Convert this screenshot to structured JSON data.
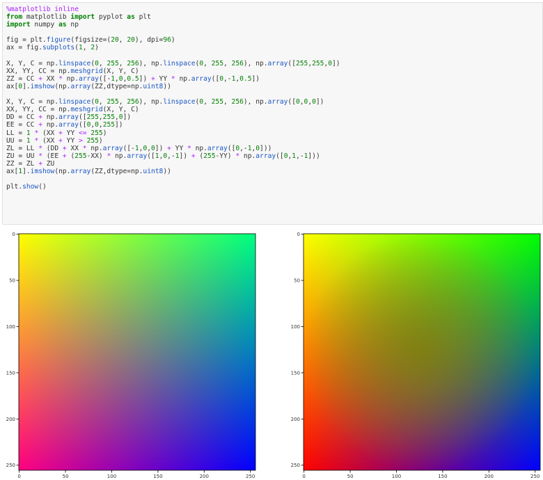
{
  "code_cell": {
    "lines": [
      [
        {
          "t": "%matplotlib inline",
          "c": "mag"
        }
      ],
      [
        {
          "t": "from",
          "c": "kw"
        },
        {
          "t": " matplotlib "
        },
        {
          "t": "import",
          "c": "kw"
        },
        {
          "t": " pyplot "
        },
        {
          "t": "as",
          "c": "kw"
        },
        {
          "t": " plt"
        }
      ],
      [
        {
          "t": "import",
          "c": "kw"
        },
        {
          "t": " numpy "
        },
        {
          "t": "as",
          "c": "kw"
        },
        {
          "t": " np"
        }
      ],
      [],
      [
        {
          "t": "fig = plt."
        },
        {
          "t": "figure",
          "c": "fn"
        },
        {
          "t": "(figsize=("
        },
        {
          "t": "20",
          "c": "num"
        },
        {
          "t": ", "
        },
        {
          "t": "20",
          "c": "num"
        },
        {
          "t": "), dpi="
        },
        {
          "t": "96",
          "c": "num"
        },
        {
          "t": ")"
        }
      ],
      [
        {
          "t": "ax = fig."
        },
        {
          "t": "subplots",
          "c": "fn"
        },
        {
          "t": "("
        },
        {
          "t": "1",
          "c": "num"
        },
        {
          "t": ", "
        },
        {
          "t": "2",
          "c": "num"
        },
        {
          "t": ")"
        }
      ],
      [],
      [
        {
          "t": "X, Y, C = np."
        },
        {
          "t": "linspace",
          "c": "fn"
        },
        {
          "t": "("
        },
        {
          "t": "0",
          "c": "num"
        },
        {
          "t": ", "
        },
        {
          "t": "255",
          "c": "num"
        },
        {
          "t": ", "
        },
        {
          "t": "256",
          "c": "num"
        },
        {
          "t": "), np."
        },
        {
          "t": "linspace",
          "c": "fn"
        },
        {
          "t": "("
        },
        {
          "t": "0",
          "c": "num"
        },
        {
          "t": ", "
        },
        {
          "t": "255",
          "c": "num"
        },
        {
          "t": ", "
        },
        {
          "t": "256",
          "c": "num"
        },
        {
          "t": "), np."
        },
        {
          "t": "array",
          "c": "fn"
        },
        {
          "t": "(["
        },
        {
          "t": "255",
          "c": "num"
        },
        {
          "t": ","
        },
        {
          "t": "255",
          "c": "num"
        },
        {
          "t": ","
        },
        {
          "t": "0",
          "c": "num"
        },
        {
          "t": "])"
        }
      ],
      [
        {
          "t": "XX, YY, CC = np."
        },
        {
          "t": "meshgrid",
          "c": "fn"
        },
        {
          "t": "(X, Y, C)"
        }
      ],
      [
        {
          "t": "ZZ = CC "
        },
        {
          "t": "+",
          "c": "op"
        },
        {
          "t": " XX "
        },
        {
          "t": "*",
          "c": "op"
        },
        {
          "t": " np."
        },
        {
          "t": "array",
          "c": "fn"
        },
        {
          "t": "([-"
        },
        {
          "t": "1",
          "c": "num"
        },
        {
          "t": ","
        },
        {
          "t": "0",
          "c": "num"
        },
        {
          "t": ","
        },
        {
          "t": "0.5",
          "c": "num"
        },
        {
          "t": "]) "
        },
        {
          "t": "+",
          "c": "op"
        },
        {
          "t": " YY "
        },
        {
          "t": "*",
          "c": "op"
        },
        {
          "t": " np."
        },
        {
          "t": "array",
          "c": "fn"
        },
        {
          "t": "(["
        },
        {
          "t": "0",
          "c": "num"
        },
        {
          "t": ",-"
        },
        {
          "t": "1",
          "c": "num"
        },
        {
          "t": ","
        },
        {
          "t": "0.5",
          "c": "num"
        },
        {
          "t": "])"
        }
      ],
      [
        {
          "t": "ax["
        },
        {
          "t": "0",
          "c": "num"
        },
        {
          "t": "]."
        },
        {
          "t": "imshow",
          "c": "fn"
        },
        {
          "t": "(np."
        },
        {
          "t": "array",
          "c": "fn"
        },
        {
          "t": "(ZZ,dtype=np."
        },
        {
          "t": "uint8",
          "c": "fn"
        },
        {
          "t": "))"
        }
      ],
      [],
      [
        {
          "t": "X, Y, C = np."
        },
        {
          "t": "linspace",
          "c": "fn"
        },
        {
          "t": "("
        },
        {
          "t": "0",
          "c": "num"
        },
        {
          "t": ", "
        },
        {
          "t": "255",
          "c": "num"
        },
        {
          "t": ", "
        },
        {
          "t": "256",
          "c": "num"
        },
        {
          "t": "), np."
        },
        {
          "t": "linspace",
          "c": "fn"
        },
        {
          "t": "("
        },
        {
          "t": "0",
          "c": "num"
        },
        {
          "t": ", "
        },
        {
          "t": "255",
          "c": "num"
        },
        {
          "t": ", "
        },
        {
          "t": "256",
          "c": "num"
        },
        {
          "t": "), np."
        },
        {
          "t": "array",
          "c": "fn"
        },
        {
          "t": "(["
        },
        {
          "t": "0",
          "c": "num"
        },
        {
          "t": ","
        },
        {
          "t": "0",
          "c": "num"
        },
        {
          "t": ","
        },
        {
          "t": "0",
          "c": "num"
        },
        {
          "t": "])"
        }
      ],
      [
        {
          "t": "XX, YY, CC = np."
        },
        {
          "t": "meshgrid",
          "c": "fn"
        },
        {
          "t": "(X, Y, C)"
        }
      ],
      [
        {
          "t": "DD = CC "
        },
        {
          "t": "+",
          "c": "op"
        },
        {
          "t": " np."
        },
        {
          "t": "array",
          "c": "fn"
        },
        {
          "t": "(["
        },
        {
          "t": "255",
          "c": "num"
        },
        {
          "t": ","
        },
        {
          "t": "255",
          "c": "num"
        },
        {
          "t": ","
        },
        {
          "t": "0",
          "c": "num"
        },
        {
          "t": "])"
        }
      ],
      [
        {
          "t": "EE = CC "
        },
        {
          "t": "+",
          "c": "op"
        },
        {
          "t": " np."
        },
        {
          "t": "array",
          "c": "fn"
        },
        {
          "t": "(["
        },
        {
          "t": "0",
          "c": "num"
        },
        {
          "t": ","
        },
        {
          "t": "0",
          "c": "num"
        },
        {
          "t": ","
        },
        {
          "t": "255",
          "c": "num"
        },
        {
          "t": "])"
        }
      ],
      [
        {
          "t": "LL = "
        },
        {
          "t": "1",
          "c": "num"
        },
        {
          "t": " "
        },
        {
          "t": "*",
          "c": "op"
        },
        {
          "t": " (XX "
        },
        {
          "t": "+",
          "c": "op"
        },
        {
          "t": " YY "
        },
        {
          "t": "<=",
          "c": "op"
        },
        {
          "t": " "
        },
        {
          "t": "255",
          "c": "num"
        },
        {
          "t": ")"
        }
      ],
      [
        {
          "t": "UU = "
        },
        {
          "t": "1",
          "c": "num"
        },
        {
          "t": " "
        },
        {
          "t": "*",
          "c": "op"
        },
        {
          "t": " (XX "
        },
        {
          "t": "+",
          "c": "op"
        },
        {
          "t": " YY "
        },
        {
          "t": ">",
          "c": "op"
        },
        {
          "t": " "
        },
        {
          "t": "255",
          "c": "num"
        },
        {
          "t": ")"
        }
      ],
      [
        {
          "t": "ZL = LL "
        },
        {
          "t": "*",
          "c": "op"
        },
        {
          "t": " (DD "
        },
        {
          "t": "+",
          "c": "op"
        },
        {
          "t": " XX "
        },
        {
          "t": "*",
          "c": "op"
        },
        {
          "t": " np."
        },
        {
          "t": "array",
          "c": "fn"
        },
        {
          "t": "([-"
        },
        {
          "t": "1",
          "c": "num"
        },
        {
          "t": ","
        },
        {
          "t": "0",
          "c": "num"
        },
        {
          "t": ","
        },
        {
          "t": "0",
          "c": "num"
        },
        {
          "t": "]) "
        },
        {
          "t": "+",
          "c": "op"
        },
        {
          "t": " YY "
        },
        {
          "t": "*",
          "c": "op"
        },
        {
          "t": " np."
        },
        {
          "t": "array",
          "c": "fn"
        },
        {
          "t": "(["
        },
        {
          "t": "0",
          "c": "num"
        },
        {
          "t": ",-"
        },
        {
          "t": "1",
          "c": "num"
        },
        {
          "t": ","
        },
        {
          "t": "0",
          "c": "num"
        },
        {
          "t": "]))"
        }
      ],
      [
        {
          "t": "ZU = UU "
        },
        {
          "t": "*",
          "c": "op"
        },
        {
          "t": " (EE "
        },
        {
          "t": "+",
          "c": "op"
        },
        {
          "t": " ("
        },
        {
          "t": "255",
          "c": "num"
        },
        {
          "t": "-XX) "
        },
        {
          "t": "*",
          "c": "op"
        },
        {
          "t": " np."
        },
        {
          "t": "array",
          "c": "fn"
        },
        {
          "t": "(["
        },
        {
          "t": "1",
          "c": "num"
        },
        {
          "t": ","
        },
        {
          "t": "0",
          "c": "num"
        },
        {
          "t": ",-"
        },
        {
          "t": "1",
          "c": "num"
        },
        {
          "t": "]) "
        },
        {
          "t": "+",
          "c": "op"
        },
        {
          "t": " ("
        },
        {
          "t": "255",
          "c": "num"
        },
        {
          "t": "-YY) "
        },
        {
          "t": "*",
          "c": "op"
        },
        {
          "t": " np."
        },
        {
          "t": "array",
          "c": "fn"
        },
        {
          "t": "(["
        },
        {
          "t": "0",
          "c": "num"
        },
        {
          "t": ","
        },
        {
          "t": "1",
          "c": "num"
        },
        {
          "t": ",-"
        },
        {
          "t": "1",
          "c": "num"
        },
        {
          "t": "]))"
        }
      ],
      [
        {
          "t": "ZZ = ZL "
        },
        {
          "t": "+",
          "c": "op"
        },
        {
          "t": " ZU"
        }
      ],
      [
        {
          "t": "ax["
        },
        {
          "t": "1",
          "c": "num"
        },
        {
          "t": "]."
        },
        {
          "t": "imshow",
          "c": "fn"
        },
        {
          "t": "(np."
        },
        {
          "t": "array",
          "c": "fn"
        },
        {
          "t": "(ZZ,dtype=np."
        },
        {
          "t": "uint8",
          "c": "fn"
        },
        {
          "t": "))"
        }
      ],
      [],
      [
        {
          "t": "plt."
        },
        {
          "t": "show",
          "c": "fn"
        },
        {
          "t": "()"
        }
      ]
    ]
  },
  "colors": {
    "left_corners": {
      "top_left": "#ffff00",
      "top_right": "#00ff80",
      "bottom_left": "#ff0080",
      "bottom_right": "#0000ff"
    },
    "right_corners": {
      "top_left": "#ffff00",
      "top_right": "#00ff00",
      "bottom_left": "#ff0000",
      "bottom_right": "#0000ff",
      "center": "#7f7f00"
    }
  },
  "chart_data": [
    {
      "type": "heatmap",
      "title": "",
      "xlim": [
        0,
        255
      ],
      "ylim": [
        255,
        0
      ],
      "x_ticks": [
        0,
        50,
        100,
        150,
        200,
        250
      ],
      "y_ticks": [
        0,
        50,
        100,
        150,
        200,
        250
      ],
      "x_tick_labels": [
        "0",
        "50",
        "100",
        "150",
        "200",
        "250"
      ],
      "y_tick_labels": [
        "0",
        "50",
        "100",
        "150",
        "200",
        "250"
      ]
    },
    {
      "type": "heatmap",
      "title": "",
      "xlim": [
        0,
        255
      ],
      "ylim": [
        255,
        0
      ],
      "x_ticks": [
        0,
        50,
        100,
        150,
        200,
        250
      ],
      "y_ticks": [
        0,
        50,
        100,
        150,
        200,
        250
      ],
      "x_tick_labels": [
        "0",
        "50",
        "100",
        "150",
        "200",
        "250"
      ],
      "y_tick_labels": [
        "0",
        "50",
        "100",
        "150",
        "200",
        "250"
      ]
    }
  ]
}
